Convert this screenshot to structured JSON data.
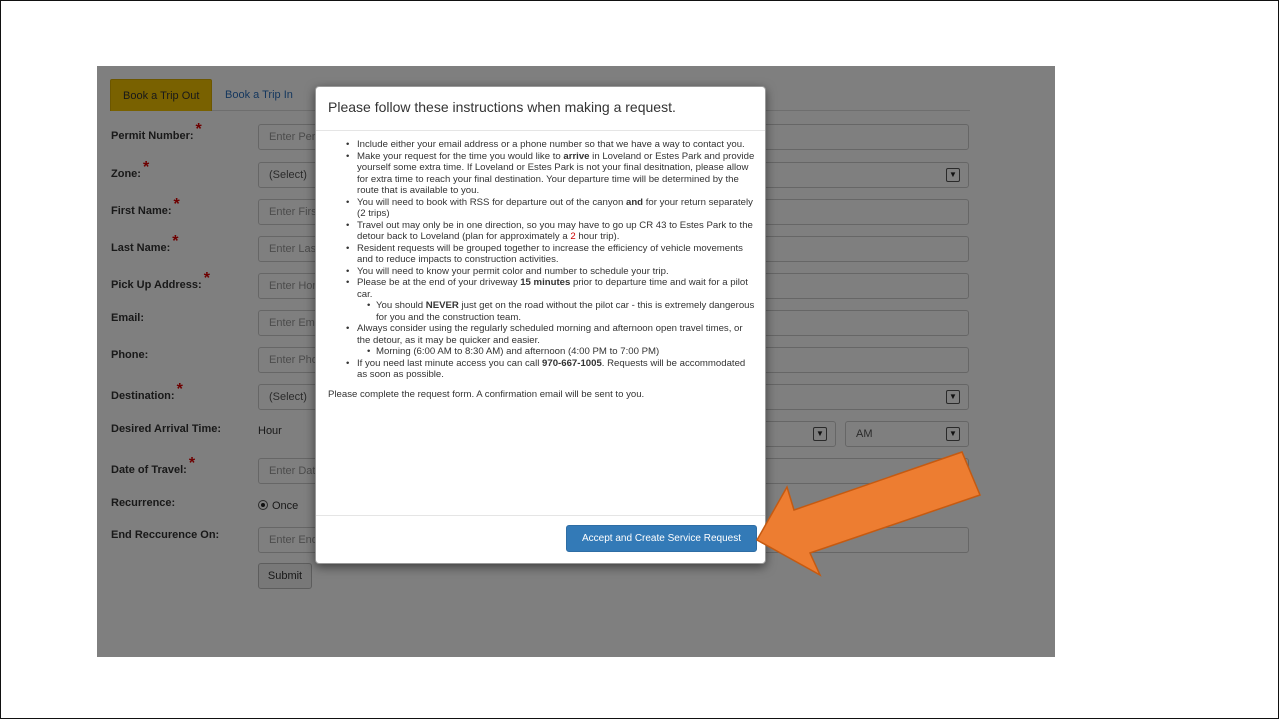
{
  "tabs": {
    "active": "Book a Trip Out",
    "other": "Book a Trip In"
  },
  "form": {
    "permit_number": {
      "label": "Permit Number:",
      "placeholder": "Enter Permit Number"
    },
    "zone": {
      "label": "Zone:",
      "value": "(Select)"
    },
    "first_name": {
      "label": "First Name:",
      "placeholder": "Enter First Name"
    },
    "last_name": {
      "label": "Last Name:",
      "placeholder": "Enter Last Name"
    },
    "pick_up_address": {
      "label": "Pick Up Address:",
      "placeholder": "Enter Home Address"
    },
    "email": {
      "label": "Email:",
      "placeholder": "Enter Email"
    },
    "phone": {
      "label": "Phone:",
      "placeholder": "Enter Phone"
    },
    "destination": {
      "label": "Destination:",
      "value": "(Select)"
    },
    "desired_arrival_time": {
      "label": "Desired Arrival Time:",
      "hour_label": "Hour",
      "ampm": "AM"
    },
    "date_of_travel": {
      "label": "Date of Travel:",
      "placeholder": "Enter Date"
    },
    "recurrence": {
      "label": "Recurrence:",
      "option_once": "Once"
    },
    "end_recurrence": {
      "label": "End Reccurence On:",
      "placeholder": "Enter End Date"
    },
    "submit_label": "Submit"
  },
  "modal": {
    "title": "Please follow these instructions when making a request.",
    "b1": "Include either your email address or a phone number so that we have a way to contact you.",
    "b2_pre": "Make your request for the time you would like to ",
    "b2_bold": "arrive",
    "b2_post": " in Loveland or Estes Park and provide yourself some extra time. If Loveland or Estes Park is not your final desitnation, please allow for extra time to reach your final destination. Your departure time will be determined by the route that is available to you.",
    "b3_pre": "You will need to book with RSS for departure out of the canyon ",
    "b3_bold": "and",
    "b3_post": " for your return separately (2 trips)",
    "b4_pre": "Travel out may only be in one direction, so you may have to go up CR 43 to Estes Park to the detour back to Loveland (plan for approximately a ",
    "b4_red": "2",
    "b4_post": " hour trip).",
    "b5": "Resident requests will be grouped together to increase the efficiency of vehicle movements and to reduce impacts to construction activities.",
    "b6": "You will need to know your permit color and number to schedule your trip.",
    "b7_pre": "Please be at the end of your driveway ",
    "b7_bold": "15 minutes",
    "b7_post": " prior to departure time and wait for a pilot car.",
    "b7_sub_pre": "You should ",
    "b7_sub_bold": "NEVER",
    "b7_sub_post": " just get on the road without the pilot car - this is extremely dangerous for you and the construction team.",
    "b8": "Always consider using the regularly scheduled morning and afternoon open travel times, or the detour, as it may be quicker and easier.",
    "b8_sub": "Morning (6:00 AM to 8:30 AM) and afternoon (4:00 PM to 7:00 PM)",
    "b9_pre": "If you need last minute access you can call ",
    "b9_bold": "970-667-1005",
    "b9_post": ". Requests will be accommodated as soon as possible.",
    "closing": "Please complete the request form. A confirmation email will be sent to you.",
    "accept_label": "Accept and Create Service Request"
  },
  "colors": {
    "accent_tab": "#f2c200",
    "primary_button": "#337ab7",
    "arrow": "#ed7d31"
  },
  "icons": {
    "select_arrow": "chevron-down-icon",
    "arrow": "arrow-pointer-icon"
  }
}
